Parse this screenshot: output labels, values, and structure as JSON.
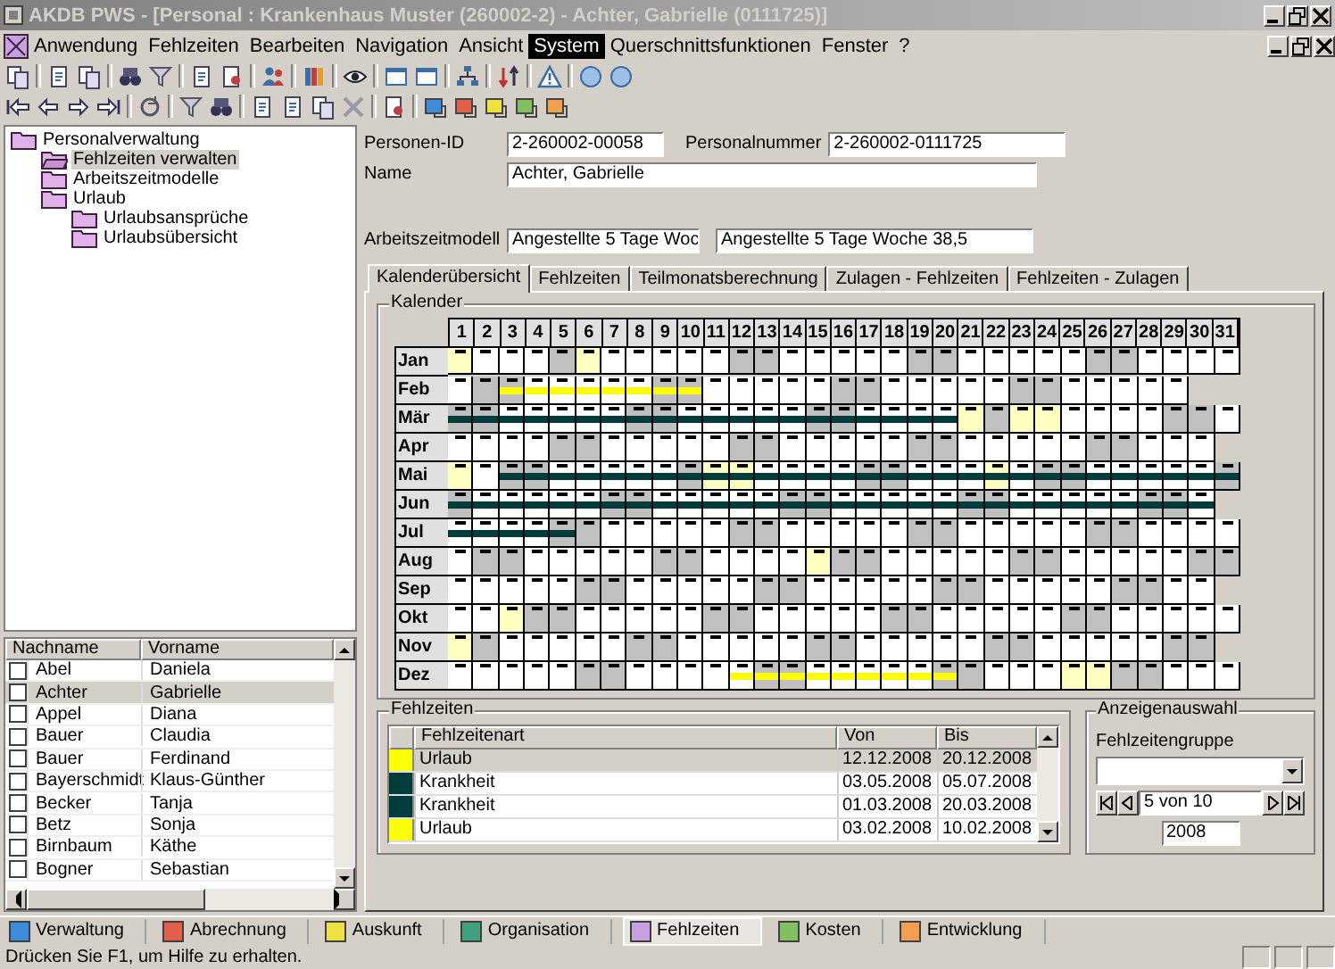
{
  "window": {
    "title": "AKDB PWS - [Personal : Krankenhaus Muster (260002-2) - Achter, Gabrielle (0111725)]"
  },
  "menu": [
    {
      "label": "Anwendung",
      "selected": false
    },
    {
      "label": "Fehlzeiten",
      "selected": false
    },
    {
      "label": "Bearbeiten",
      "selected": false
    },
    {
      "label": "Navigation",
      "selected": false
    },
    {
      "label": "Ansicht",
      "selected": false
    },
    {
      "label": "System",
      "selected": true
    },
    {
      "label": "Querschnittsfunktionen",
      "selected": false
    },
    {
      "label": "Fenster",
      "selected": false
    },
    {
      "label": "?",
      "selected": false
    }
  ],
  "tree": [
    {
      "label": "Personalverwaltung",
      "selected": false,
      "children": [
        {
          "label": "Fehlzeiten verwalten",
          "selected": true
        },
        {
          "label": "Arbeitszeitmodelle",
          "selected": false
        },
        {
          "label": "Urlaub",
          "selected": false,
          "children": [
            {
              "label": "Urlaubsansprüche",
              "selected": false
            },
            {
              "label": "Urlaubsübersicht",
              "selected": false
            }
          ]
        }
      ]
    }
  ],
  "person_list": {
    "columns": [
      "Nachname",
      "Vorname"
    ],
    "rows": [
      {
        "last": "Abel",
        "first": "Daniela",
        "checked": false,
        "selected": false
      },
      {
        "last": "Achter",
        "first": "Gabrielle",
        "checked": false,
        "selected": true
      },
      {
        "last": "Appel",
        "first": "Diana",
        "checked": false,
        "selected": false
      },
      {
        "last": "Bauer",
        "first": "Claudia",
        "checked": false,
        "selected": false
      },
      {
        "last": "Bauer",
        "first": "Ferdinand",
        "checked": false,
        "selected": false
      },
      {
        "last": "Bayerschmidt",
        "first": "Klaus-Günther",
        "checked": false,
        "selected": false
      },
      {
        "last": "Becker",
        "first": "Tanja",
        "checked": false,
        "selected": false
      },
      {
        "last": "Betz",
        "first": "Sonja",
        "checked": false,
        "selected": false
      },
      {
        "last": "Birnbaum",
        "first": "Käthe",
        "checked": false,
        "selected": false
      },
      {
        "last": "Bogner",
        "first": "Sebastian",
        "checked": false,
        "selected": false
      }
    ]
  },
  "person": {
    "id_label": "Personen-ID",
    "id": "2-260002-00058",
    "number_label": "Personalnummer",
    "number": "2-260002-0111725",
    "name_label": "Name",
    "name": "Achter, Gabrielle",
    "model_label": "Arbeitszeitmodell",
    "model_code": "Angestellte 5 Tage Woc",
    "model_name": "Angestellte 5 Tage Woche 38,5"
  },
  "tabs": [
    {
      "label": "Kalenderübersicht",
      "selected": true
    },
    {
      "label": "Fehlzeiten",
      "selected": false
    },
    {
      "label": "Teilmonatsberechnung",
      "selected": false
    },
    {
      "label": "Zulagen - Fehlzeiten",
      "selected": false
    },
    {
      "label": "Fehlzeiten - Zulagen",
      "selected": false
    }
  ],
  "calendar": {
    "title": "Kalender",
    "day_numbers": [
      "1",
      "2",
      "3",
      "4",
      "5",
      "6",
      "7",
      "8",
      "9",
      "10",
      "11",
      "12",
      "13",
      "14",
      "15",
      "16",
      "17",
      "18",
      "19",
      "20",
      "21",
      "22",
      "23",
      "24",
      "25",
      "26",
      "27",
      "28",
      "29",
      "30",
      "31"
    ],
    "months": [
      {
        "label": "Jan",
        "days": [
          {
            "kind": "holiday"
          },
          {
            "kind": "work"
          },
          {
            "kind": "work"
          },
          {
            "kind": "work"
          },
          {
            "kind": "weekend"
          },
          {
            "kind": "holiday"
          },
          {
            "kind": "work"
          },
          {
            "kind": "work"
          },
          {
            "kind": "work"
          },
          {
            "kind": "work"
          },
          {
            "kind": "work"
          },
          {
            "kind": "weekend"
          },
          {
            "kind": "weekend"
          },
          {
            "kind": "work"
          },
          {
            "kind": "work"
          },
          {
            "kind": "work"
          },
          {
            "kind": "work"
          },
          {
            "kind": "work"
          },
          {
            "kind": "weekend"
          },
          {
            "kind": "weekend"
          },
          {
            "kind": "work"
          },
          {
            "kind": "work"
          },
          {
            "kind": "work"
          },
          {
            "kind": "work"
          },
          {
            "kind": "work"
          },
          {
            "kind": "weekend"
          },
          {
            "kind": "weekend"
          },
          {
            "kind": "work"
          },
          {
            "kind": "work"
          },
          {
            "kind": "work"
          },
          {
            "kind": "work"
          }
        ]
      },
      {
        "label": "Feb",
        "days": [
          {
            "kind": "work"
          },
          {
            "kind": "weekend"
          },
          {
            "kind": "weekend"
          },
          {
            "kind": "work"
          },
          {
            "kind": "work"
          },
          {
            "kind": "work"
          },
          {
            "kind": "work"
          },
          {
            "kind": "work"
          },
          {
            "kind": "weekend"
          },
          {
            "kind": "weekend"
          },
          {
            "kind": "work"
          },
          {
            "kind": "work"
          },
          {
            "kind": "work"
          },
          {
            "kind": "work"
          },
          {
            "kind": "work"
          },
          {
            "kind": "weekend"
          },
          {
            "kind": "weekend"
          },
          {
            "kind": "work"
          },
          {
            "kind": "work"
          },
          {
            "kind": "work"
          },
          {
            "kind": "work"
          },
          {
            "kind": "work"
          },
          {
            "kind": "weekend"
          },
          {
            "kind": "weekend"
          },
          {
            "kind": "work"
          },
          {
            "kind": "work"
          },
          {
            "kind": "work"
          },
          {
            "kind": "work"
          },
          {
            "kind": "work"
          }
        ]
      },
      {
        "label": "Mär",
        "days": [
          {
            "kind": "weekend"
          },
          {
            "kind": "weekend"
          },
          {
            "kind": "work"
          },
          {
            "kind": "work"
          },
          {
            "kind": "work"
          },
          {
            "kind": "work"
          },
          {
            "kind": "work"
          },
          {
            "kind": "weekend"
          },
          {
            "kind": "weekend"
          },
          {
            "kind": "work"
          },
          {
            "kind": "work"
          },
          {
            "kind": "work"
          },
          {
            "kind": "work"
          },
          {
            "kind": "work"
          },
          {
            "kind": "weekend"
          },
          {
            "kind": "weekend"
          },
          {
            "kind": "work"
          },
          {
            "kind": "work"
          },
          {
            "kind": "work"
          },
          {
            "kind": "work"
          },
          {
            "kind": "holiday"
          },
          {
            "kind": "weekend"
          },
          {
            "kind": "holiday"
          },
          {
            "kind": "holiday"
          },
          {
            "kind": "work"
          },
          {
            "kind": "work"
          },
          {
            "kind": "work"
          },
          {
            "kind": "work"
          },
          {
            "kind": "weekend"
          },
          {
            "kind": "weekend"
          },
          {
            "kind": "work"
          }
        ]
      },
      {
        "label": "Apr",
        "days": [
          {
            "kind": "work"
          },
          {
            "kind": "work"
          },
          {
            "kind": "work"
          },
          {
            "kind": "work"
          },
          {
            "kind": "weekend"
          },
          {
            "kind": "weekend"
          },
          {
            "kind": "work"
          },
          {
            "kind": "work"
          },
          {
            "kind": "work"
          },
          {
            "kind": "work"
          },
          {
            "kind": "work"
          },
          {
            "kind": "weekend"
          },
          {
            "kind": "weekend"
          },
          {
            "kind": "work"
          },
          {
            "kind": "work"
          },
          {
            "kind": "work"
          },
          {
            "kind": "work"
          },
          {
            "kind": "work"
          },
          {
            "kind": "weekend"
          },
          {
            "kind": "weekend"
          },
          {
            "kind": "work"
          },
          {
            "kind": "work"
          },
          {
            "kind": "work"
          },
          {
            "kind": "work"
          },
          {
            "kind": "work"
          },
          {
            "kind": "weekend"
          },
          {
            "kind": "weekend"
          },
          {
            "kind": "work"
          },
          {
            "kind": "work"
          },
          {
            "kind": "work"
          }
        ]
      },
      {
        "label": "Mai",
        "days": [
          {
            "kind": "holiday"
          },
          {
            "kind": "work"
          },
          {
            "kind": "weekend"
          },
          {
            "kind": "weekend"
          },
          {
            "kind": "work"
          },
          {
            "kind": "work"
          },
          {
            "kind": "work"
          },
          {
            "kind": "work"
          },
          {
            "kind": "work"
          },
          {
            "kind": "weekend"
          },
          {
            "kind": "holiday"
          },
          {
            "kind": "holiday"
          },
          {
            "kind": "work"
          },
          {
            "kind": "work"
          },
          {
            "kind": "work"
          },
          {
            "kind": "work"
          },
          {
            "kind": "weekend"
          },
          {
            "kind": "weekend"
          },
          {
            "kind": "work"
          },
          {
            "kind": "work"
          },
          {
            "kind": "work"
          },
          {
            "kind": "holiday"
          },
          {
            "kind": "work"
          },
          {
            "kind": "weekend"
          },
          {
            "kind": "weekend"
          },
          {
            "kind": "work"
          },
          {
            "kind": "work"
          },
          {
            "kind": "work"
          },
          {
            "kind": "work"
          },
          {
            "kind": "work"
          },
          {
            "kind": "weekend"
          }
        ]
      },
      {
        "label": "Jun",
        "days": [
          {
            "kind": "weekend"
          },
          {
            "kind": "work"
          },
          {
            "kind": "work"
          },
          {
            "kind": "work"
          },
          {
            "kind": "work"
          },
          {
            "kind": "work"
          },
          {
            "kind": "weekend"
          },
          {
            "kind": "weekend"
          },
          {
            "kind": "work"
          },
          {
            "kind": "work"
          },
          {
            "kind": "work"
          },
          {
            "kind": "work"
          },
          {
            "kind": "work"
          },
          {
            "kind": "weekend"
          },
          {
            "kind": "weekend"
          },
          {
            "kind": "work"
          },
          {
            "kind": "work"
          },
          {
            "kind": "work"
          },
          {
            "kind": "work"
          },
          {
            "kind": "work"
          },
          {
            "kind": "weekend"
          },
          {
            "kind": "weekend"
          },
          {
            "kind": "work"
          },
          {
            "kind": "work"
          },
          {
            "kind": "work"
          },
          {
            "kind": "work"
          },
          {
            "kind": "work"
          },
          {
            "kind": "weekend"
          },
          {
            "kind": "weekend"
          },
          {
            "kind": "work"
          }
        ]
      },
      {
        "label": "Jul",
        "days": [
          {
            "kind": "work"
          },
          {
            "kind": "work"
          },
          {
            "kind": "work"
          },
          {
            "kind": "work"
          },
          {
            "kind": "weekend"
          },
          {
            "kind": "weekend"
          },
          {
            "kind": "work"
          },
          {
            "kind": "work"
          },
          {
            "kind": "work"
          },
          {
            "kind": "work"
          },
          {
            "kind": "work"
          },
          {
            "kind": "weekend"
          },
          {
            "kind": "weekend"
          },
          {
            "kind": "work"
          },
          {
            "kind": "work"
          },
          {
            "kind": "work"
          },
          {
            "kind": "work"
          },
          {
            "kind": "work"
          },
          {
            "kind": "weekend"
          },
          {
            "kind": "weekend"
          },
          {
            "kind": "work"
          },
          {
            "kind": "work"
          },
          {
            "kind": "work"
          },
          {
            "kind": "work"
          },
          {
            "kind": "work"
          },
          {
            "kind": "weekend"
          },
          {
            "kind": "weekend"
          },
          {
            "kind": "work"
          },
          {
            "kind": "work"
          },
          {
            "kind": "work"
          },
          {
            "kind": "work"
          }
        ]
      },
      {
        "label": "Aug",
        "days": [
          {
            "kind": "work"
          },
          {
            "kind": "weekend"
          },
          {
            "kind": "weekend"
          },
          {
            "kind": "work"
          },
          {
            "kind": "work"
          },
          {
            "kind": "work"
          },
          {
            "kind": "work"
          },
          {
            "kind": "work"
          },
          {
            "kind": "weekend"
          },
          {
            "kind": "weekend"
          },
          {
            "kind": "work"
          },
          {
            "kind": "work"
          },
          {
            "kind": "work"
          },
          {
            "kind": "work"
          },
          {
            "kind": "holiday"
          },
          {
            "kind": "weekend"
          },
          {
            "kind": "weekend"
          },
          {
            "kind": "work"
          },
          {
            "kind": "work"
          },
          {
            "kind": "work"
          },
          {
            "kind": "work"
          },
          {
            "kind": "work"
          },
          {
            "kind": "weekend"
          },
          {
            "kind": "weekend"
          },
          {
            "kind": "work"
          },
          {
            "kind": "work"
          },
          {
            "kind": "work"
          },
          {
            "kind": "work"
          },
          {
            "kind": "work"
          },
          {
            "kind": "weekend"
          },
          {
            "kind": "weekend"
          }
        ]
      },
      {
        "label": "Sep",
        "days": [
          {
            "kind": "work"
          },
          {
            "kind": "work"
          },
          {
            "kind": "work"
          },
          {
            "kind": "work"
          },
          {
            "kind": "work"
          },
          {
            "kind": "weekend"
          },
          {
            "kind": "weekend"
          },
          {
            "kind": "work"
          },
          {
            "kind": "work"
          },
          {
            "kind": "work"
          },
          {
            "kind": "work"
          },
          {
            "kind": "work"
          },
          {
            "kind": "weekend"
          },
          {
            "kind": "weekend"
          },
          {
            "kind": "work"
          },
          {
            "kind": "work"
          },
          {
            "kind": "work"
          },
          {
            "kind": "work"
          },
          {
            "kind": "work"
          },
          {
            "kind": "weekend"
          },
          {
            "kind": "weekend"
          },
          {
            "kind": "work"
          },
          {
            "kind": "work"
          },
          {
            "kind": "work"
          },
          {
            "kind": "work"
          },
          {
            "kind": "work"
          },
          {
            "kind": "weekend"
          },
          {
            "kind": "weekend"
          },
          {
            "kind": "work"
          },
          {
            "kind": "work"
          }
        ]
      },
      {
        "label": "Okt",
        "days": [
          {
            "kind": "work"
          },
          {
            "kind": "work"
          },
          {
            "kind": "holiday"
          },
          {
            "kind": "weekend"
          },
          {
            "kind": "weekend"
          },
          {
            "kind": "work"
          },
          {
            "kind": "work"
          },
          {
            "kind": "work"
          },
          {
            "kind": "work"
          },
          {
            "kind": "work"
          },
          {
            "kind": "weekend"
          },
          {
            "kind": "weekend"
          },
          {
            "kind": "work"
          },
          {
            "kind": "work"
          },
          {
            "kind": "work"
          },
          {
            "kind": "work"
          },
          {
            "kind": "work"
          },
          {
            "kind": "weekend"
          },
          {
            "kind": "weekend"
          },
          {
            "kind": "work"
          },
          {
            "kind": "work"
          },
          {
            "kind": "work"
          },
          {
            "kind": "work"
          },
          {
            "kind": "work"
          },
          {
            "kind": "weekend"
          },
          {
            "kind": "weekend"
          },
          {
            "kind": "work"
          },
          {
            "kind": "work"
          },
          {
            "kind": "work"
          },
          {
            "kind": "work"
          },
          {
            "kind": "work"
          }
        ]
      },
      {
        "label": "Nov",
        "days": [
          {
            "kind": "holiday"
          },
          {
            "kind": "weekend"
          },
          {
            "kind": "work"
          },
          {
            "kind": "work"
          },
          {
            "kind": "work"
          },
          {
            "kind": "work"
          },
          {
            "kind": "work"
          },
          {
            "kind": "weekend"
          },
          {
            "kind": "weekend"
          },
          {
            "kind": "work"
          },
          {
            "kind": "work"
          },
          {
            "kind": "work"
          },
          {
            "kind": "work"
          },
          {
            "kind": "work"
          },
          {
            "kind": "weekend"
          },
          {
            "kind": "weekend"
          },
          {
            "kind": "work"
          },
          {
            "kind": "work"
          },
          {
            "kind": "work"
          },
          {
            "kind": "work"
          },
          {
            "kind": "work"
          },
          {
            "kind": "weekend"
          },
          {
            "kind": "weekend"
          },
          {
            "kind": "work"
          },
          {
            "kind": "work"
          },
          {
            "kind": "work"
          },
          {
            "kind": "work"
          },
          {
            "kind": "work"
          },
          {
            "kind": "weekend"
          },
          {
            "kind": "weekend"
          }
        ]
      },
      {
        "label": "Dez",
        "days": [
          {
            "kind": "work"
          },
          {
            "kind": "work"
          },
          {
            "kind": "work"
          },
          {
            "kind": "work"
          },
          {
            "kind": "work"
          },
          {
            "kind": "weekend"
          },
          {
            "kind": "weekend"
          },
          {
            "kind": "work"
          },
          {
            "kind": "work"
          },
          {
            "kind": "work"
          },
          {
            "kind": "work"
          },
          {
            "kind": "work"
          },
          {
            "kind": "weekend"
          },
          {
            "kind": "weekend"
          },
          {
            "kind": "work"
          },
          {
            "kind": "work"
          },
          {
            "kind": "work"
          },
          {
            "kind": "work"
          },
          {
            "kind": "work"
          },
          {
            "kind": "weekend"
          },
          {
            "kind": "weekend"
          },
          {
            "kind": "work"
          },
          {
            "kind": "work"
          },
          {
            "kind": "work"
          },
          {
            "kind": "holiday"
          },
          {
            "kind": "holiday"
          },
          {
            "kind": "weekend"
          },
          {
            "kind": "weekend"
          },
          {
            "kind": "work"
          },
          {
            "kind": "work"
          },
          {
            "kind": "work"
          }
        ]
      }
    ]
  },
  "absences": {
    "title": "Fehlzeiten",
    "columns": [
      "Fehlzeitenart",
      "Von",
      "Bis"
    ],
    "rows": [
      {
        "type": "Urlaub",
        "from": "12.12.2008",
        "to": "20.12.2008",
        "color": "#ffff00",
        "selected": true
      },
      {
        "type": "Krankheit",
        "from": "03.05.2008",
        "to": "05.07.2008",
        "color": "#003c3c",
        "selected": false
      },
      {
        "type": "Krankheit",
        "from": "01.03.2008",
        "to": "20.03.2008",
        "color": "#003c3c",
        "selected": false
      },
      {
        "type": "Urlaub",
        "from": "03.02.2008",
        "to": "10.02.2008",
        "color": "#ffff00",
        "selected": false
      }
    ]
  },
  "display": {
    "title": "Anzeigenauswahl",
    "group_label": "Fehlzeitengruppe",
    "record": "5 von 10",
    "year": "2008"
  },
  "modules": [
    {
      "label": "Verwaltung",
      "color": "#3c8edc",
      "selected": false
    },
    {
      "label": "Abrechnung",
      "color": "#e0604c",
      "selected": false
    },
    {
      "label": "Auskunft",
      "color": "#f0e040",
      "selected": false
    },
    {
      "label": "Organisation",
      "color": "#40a080",
      "selected": false
    },
    {
      "label": "Fehlzeiten",
      "color": "#c8a0e0",
      "selected": true
    },
    {
      "label": "Kosten",
      "color": "#80c060",
      "selected": false
    },
    {
      "label": "Entwicklung",
      "color": "#f0a050",
      "selected": false
    }
  ],
  "status_bar": {
    "text": "Drücken Sie F1, um Hilfe zu erhalten."
  }
}
